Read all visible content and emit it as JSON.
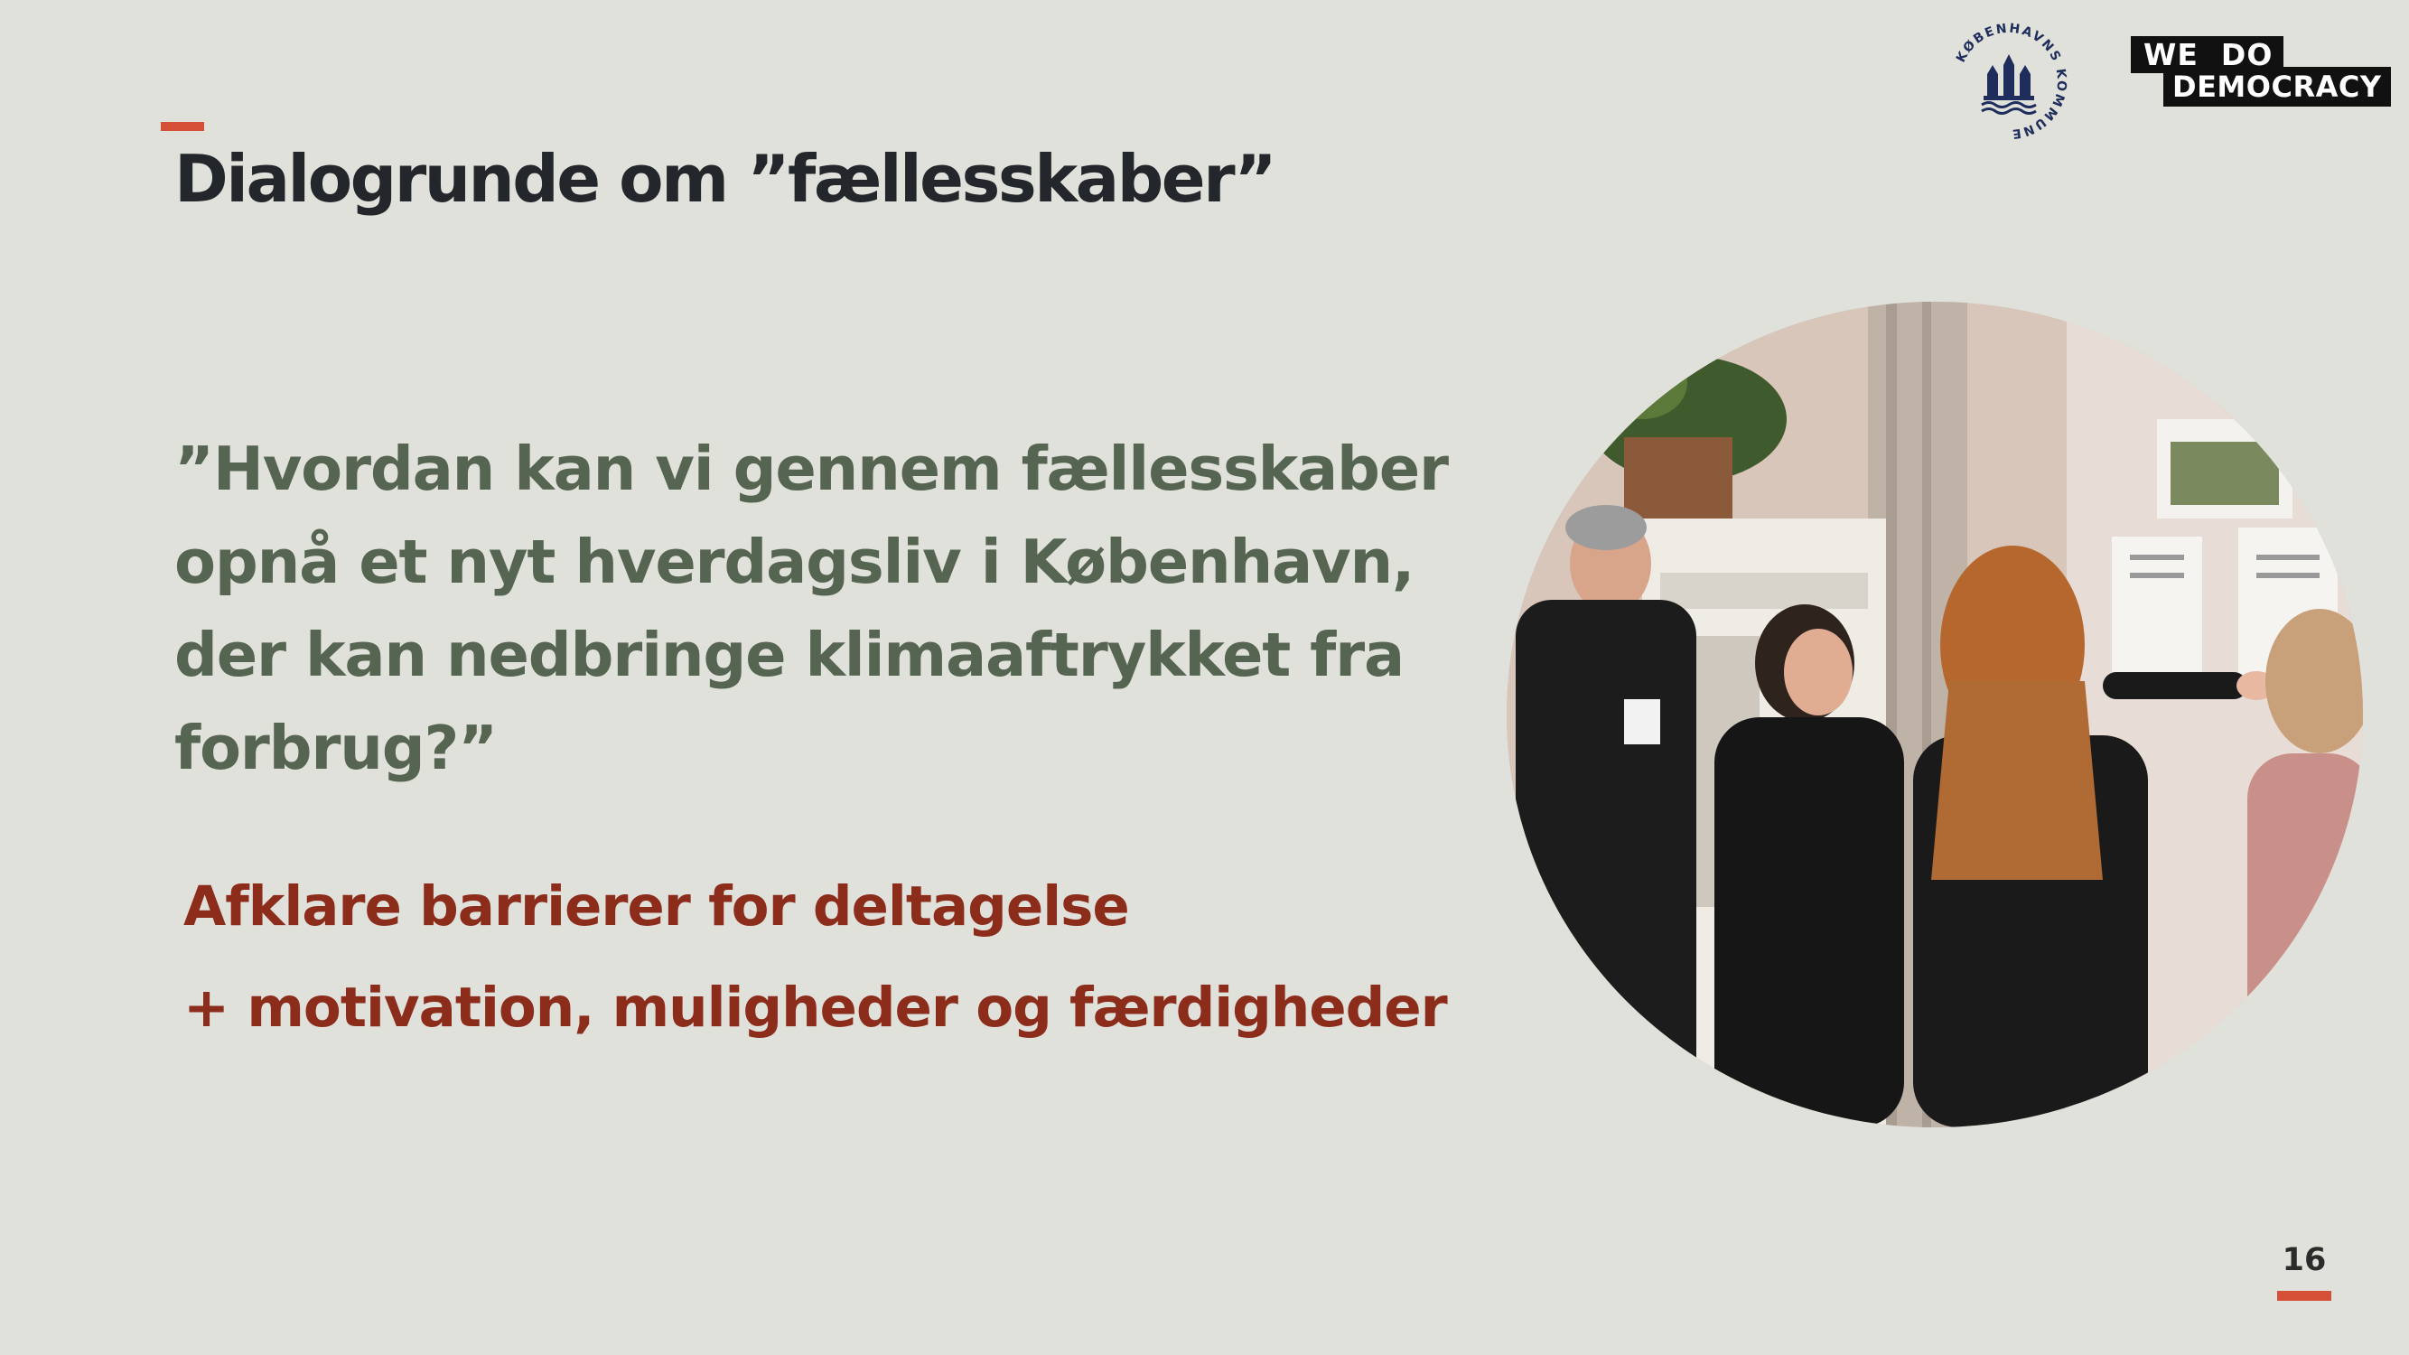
{
  "slide": {
    "title": "Dialogrunde om ”fællesskaber”",
    "question": "”Hvordan kan vi gennem fællesskaber opnå et nyt hverdagsliv i København, der kan nedbringe klimaaftrykket fra forbrug?”",
    "points": [
      "Afklare barrierer for deltagelse",
      "+ motivation, muligheder og færdigheder"
    ],
    "page_number": "16"
  },
  "logos": {
    "kobenhavn": "KØBENHAVNS KOMMUNE",
    "wedodemocracy_line1": "WE  DO",
    "wedodemocracy_line2": "DEMOCRACY"
  },
  "photo": {
    "icon": "event-photo"
  },
  "colors": {
    "background": "#e1e1dc",
    "title": "#23262a",
    "question": "#566552",
    "points": "#8c2c1b",
    "accent": "#d65038"
  }
}
